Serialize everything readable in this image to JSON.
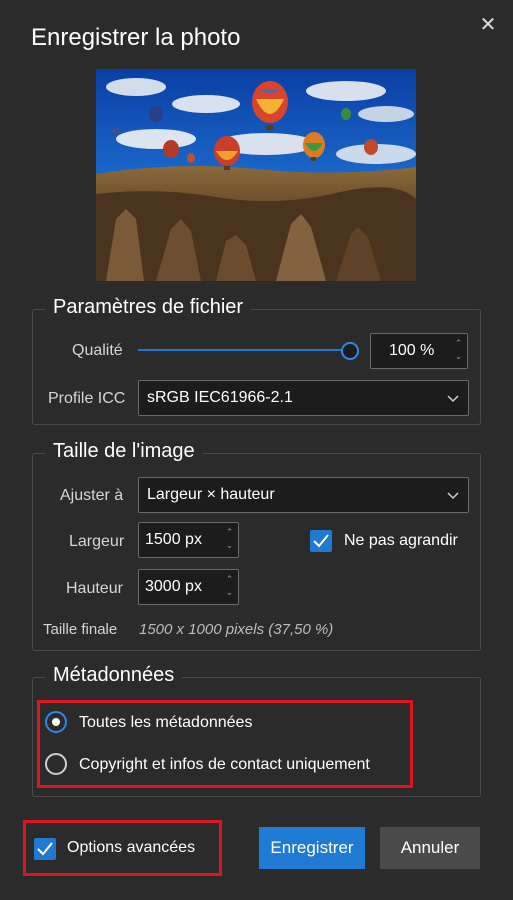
{
  "dialog": {
    "title": "Enregistrer la photo",
    "close_icon": "close-icon"
  },
  "file_settings": {
    "legend": "Paramètres de fichier",
    "quality_label": "Qualité",
    "quality_value": "100 %",
    "quality_slider_fraction": 1.0,
    "icc_label": "Profile ICC",
    "icc_value": "sRGB IEC61966-2.1"
  },
  "image_size": {
    "legend": "Taille de l'image",
    "fit_label": "Ajuster à",
    "fit_value": "Largeur × hauteur",
    "width_label": "Largeur",
    "width_value": "1500 px",
    "height_label": "Hauteur",
    "height_value": "3000 px",
    "no_enlarge_label": "Ne pas agrandir",
    "no_enlarge_checked": true,
    "final_size_label": "Taille finale",
    "final_size_value": "1500 x 1000 pixels (37,50 %)"
  },
  "metadata": {
    "legend": "Métadonnées",
    "options": [
      {
        "label": "Toutes les métadonnées",
        "selected": true
      },
      {
        "label": "Copyright et infos de contact uniquement",
        "selected": false
      }
    ]
  },
  "footer": {
    "advanced_label": "Options avancées",
    "advanced_checked": true,
    "save_label": "Enregistrer",
    "cancel_label": "Annuler"
  },
  "colors": {
    "accent": "#1f7ad3",
    "highlight": "#e0141e",
    "background": "#2b2b2b"
  }
}
